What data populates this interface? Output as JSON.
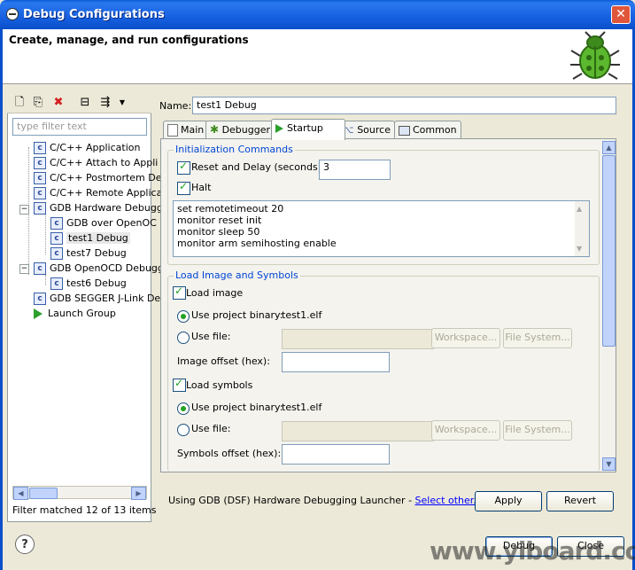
{
  "window": {
    "title": "Debug Configurations"
  },
  "header": {
    "title": "Create, manage, and run configurations"
  },
  "left": {
    "filter_placeholder": "type filter text",
    "tree": [
      {
        "label": "C/C++ Application"
      },
      {
        "label": "C/C++ Attach to Appli"
      },
      {
        "label": "C/C++ Postmortem De"
      },
      {
        "label": "C/C++ Remote Applica"
      },
      {
        "label": "GDB Hardware Debugg",
        "expanded": true
      },
      {
        "label": "GDB over OpenOC"
      },
      {
        "label": "test1 Debug",
        "selected": true
      },
      {
        "label": "test7 Debug"
      },
      {
        "label": "GDB OpenOCD Debugg",
        "expanded": true
      },
      {
        "label": "test6 Debug"
      },
      {
        "label": "GDB SEGGER J-Link De"
      },
      {
        "label": "Launch Group"
      }
    ],
    "filter_status": "Filter matched 12 of 13 items"
  },
  "config": {
    "name_label": "Name:",
    "name_value": "test1 Debug",
    "tabs": [
      "Main",
      "Debugger",
      "Startup",
      "Source",
      "Common"
    ],
    "active_tab": "Startup"
  },
  "startup": {
    "init_group": "Initialization Commands",
    "reset_label": "Reset and Delay (seconds):",
    "reset_value": "3",
    "halt_label": "Halt",
    "init_commands": [
      "set remotetimeout 20",
      "monitor reset init",
      "monitor sleep 50",
      "monitor arm semihosting enable"
    ],
    "load_group": "Load Image and Symbols",
    "load_image_label": "Load image",
    "use_project_binary": "Use project binary:",
    "image_binary": "test1.elf",
    "use_file": "Use file:",
    "workspace_btn": "Workspace...",
    "filesystem_btn": "File System...",
    "image_offset_label": "Image offset (hex):",
    "load_symbols_label": "Load symbols",
    "symbols_binary": "test1.elf",
    "symbols_offset_label": "Symbols offset (hex):"
  },
  "footer": {
    "launcher_text": "Using GDB (DSF) Hardware Debugging Launcher -",
    "launcher_link": "Select other...",
    "apply": "Apply",
    "revert": "Revert",
    "debug": "Debug",
    "close": "Close"
  },
  "watermark": "www.yiboard.com",
  "colors": {
    "title_bar": "#0a5ad8",
    "group_title": "#0046d5",
    "selection": "#316ac5"
  }
}
